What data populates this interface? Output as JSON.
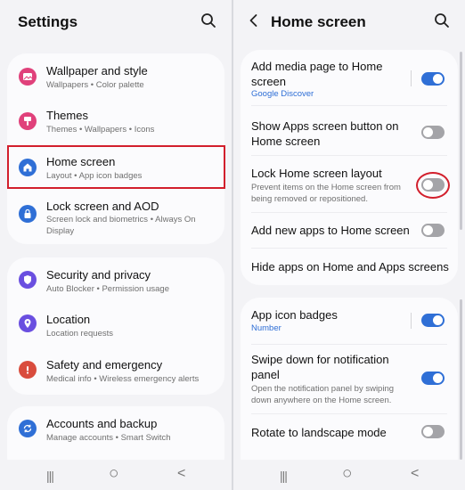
{
  "left": {
    "title": "Settings",
    "groups": [
      [
        {
          "title": "Wallpaper and style",
          "subtitle": "Wallpapers  •  Color palette",
          "icon": "palette-icon",
          "color": "#e0417b"
        },
        {
          "title": "Themes",
          "subtitle": "Themes  •  Wallpapers  •  Icons",
          "icon": "brush-icon",
          "color": "#e0417b"
        },
        {
          "title": "Home screen",
          "subtitle": "Layout  •  App icon badges",
          "icon": "home-icon",
          "color": "#2f6fd6"
        },
        {
          "title": "Lock screen and AOD",
          "subtitle": "Screen lock and biometrics  •  Always On Display",
          "icon": "lock-icon",
          "color": "#2f6fd6"
        }
      ],
      [
        {
          "title": "Security and privacy",
          "subtitle": "Auto Blocker  •  Permission usage",
          "icon": "shield-icon",
          "color": "#6a4fe0"
        },
        {
          "title": "Location",
          "subtitle": "Location requests",
          "icon": "location-pin-icon",
          "color": "#6a4fe0"
        },
        {
          "title": "Safety and emergency",
          "subtitle": "Medical info  •  Wireless emergency alerts",
          "icon": "alert-icon",
          "color": "#d94c3d"
        }
      ],
      [
        {
          "title": "Accounts and backup",
          "subtitle": "Manage accounts  •  Smart Switch",
          "icon": "sync-icon",
          "color": "#2f6fd6"
        }
      ]
    ]
  },
  "right": {
    "title": "Home screen",
    "card1": {
      "items": [
        {
          "title": "Add media page to Home screen",
          "link": "Google Discover",
          "toggle": true
        },
        {
          "title": "Show Apps screen button on Home screen",
          "toggle": false
        },
        {
          "title": "Lock Home screen layout",
          "subtitle": "Prevent items on the Home screen from being removed or repositioned.",
          "toggle": false
        },
        {
          "title": "Add new apps to Home screen",
          "toggle": false
        },
        {
          "title": "Hide apps on Home and Apps screens"
        }
      ]
    },
    "card2": {
      "items": [
        {
          "title": "App icon badges",
          "link": "Number",
          "toggle": true
        },
        {
          "title": "Swipe down for notification panel",
          "subtitle": "Open the notification panel by swiping down anywhere on the Home screen.",
          "toggle": true
        },
        {
          "title": "Rotate to landscape mode",
          "toggle": false
        }
      ]
    }
  },
  "nav": {
    "recents": "|||",
    "home": "○",
    "back": "<"
  },
  "colors": {
    "accent": "#2f6fd6",
    "highlight": "#d21f2c"
  }
}
